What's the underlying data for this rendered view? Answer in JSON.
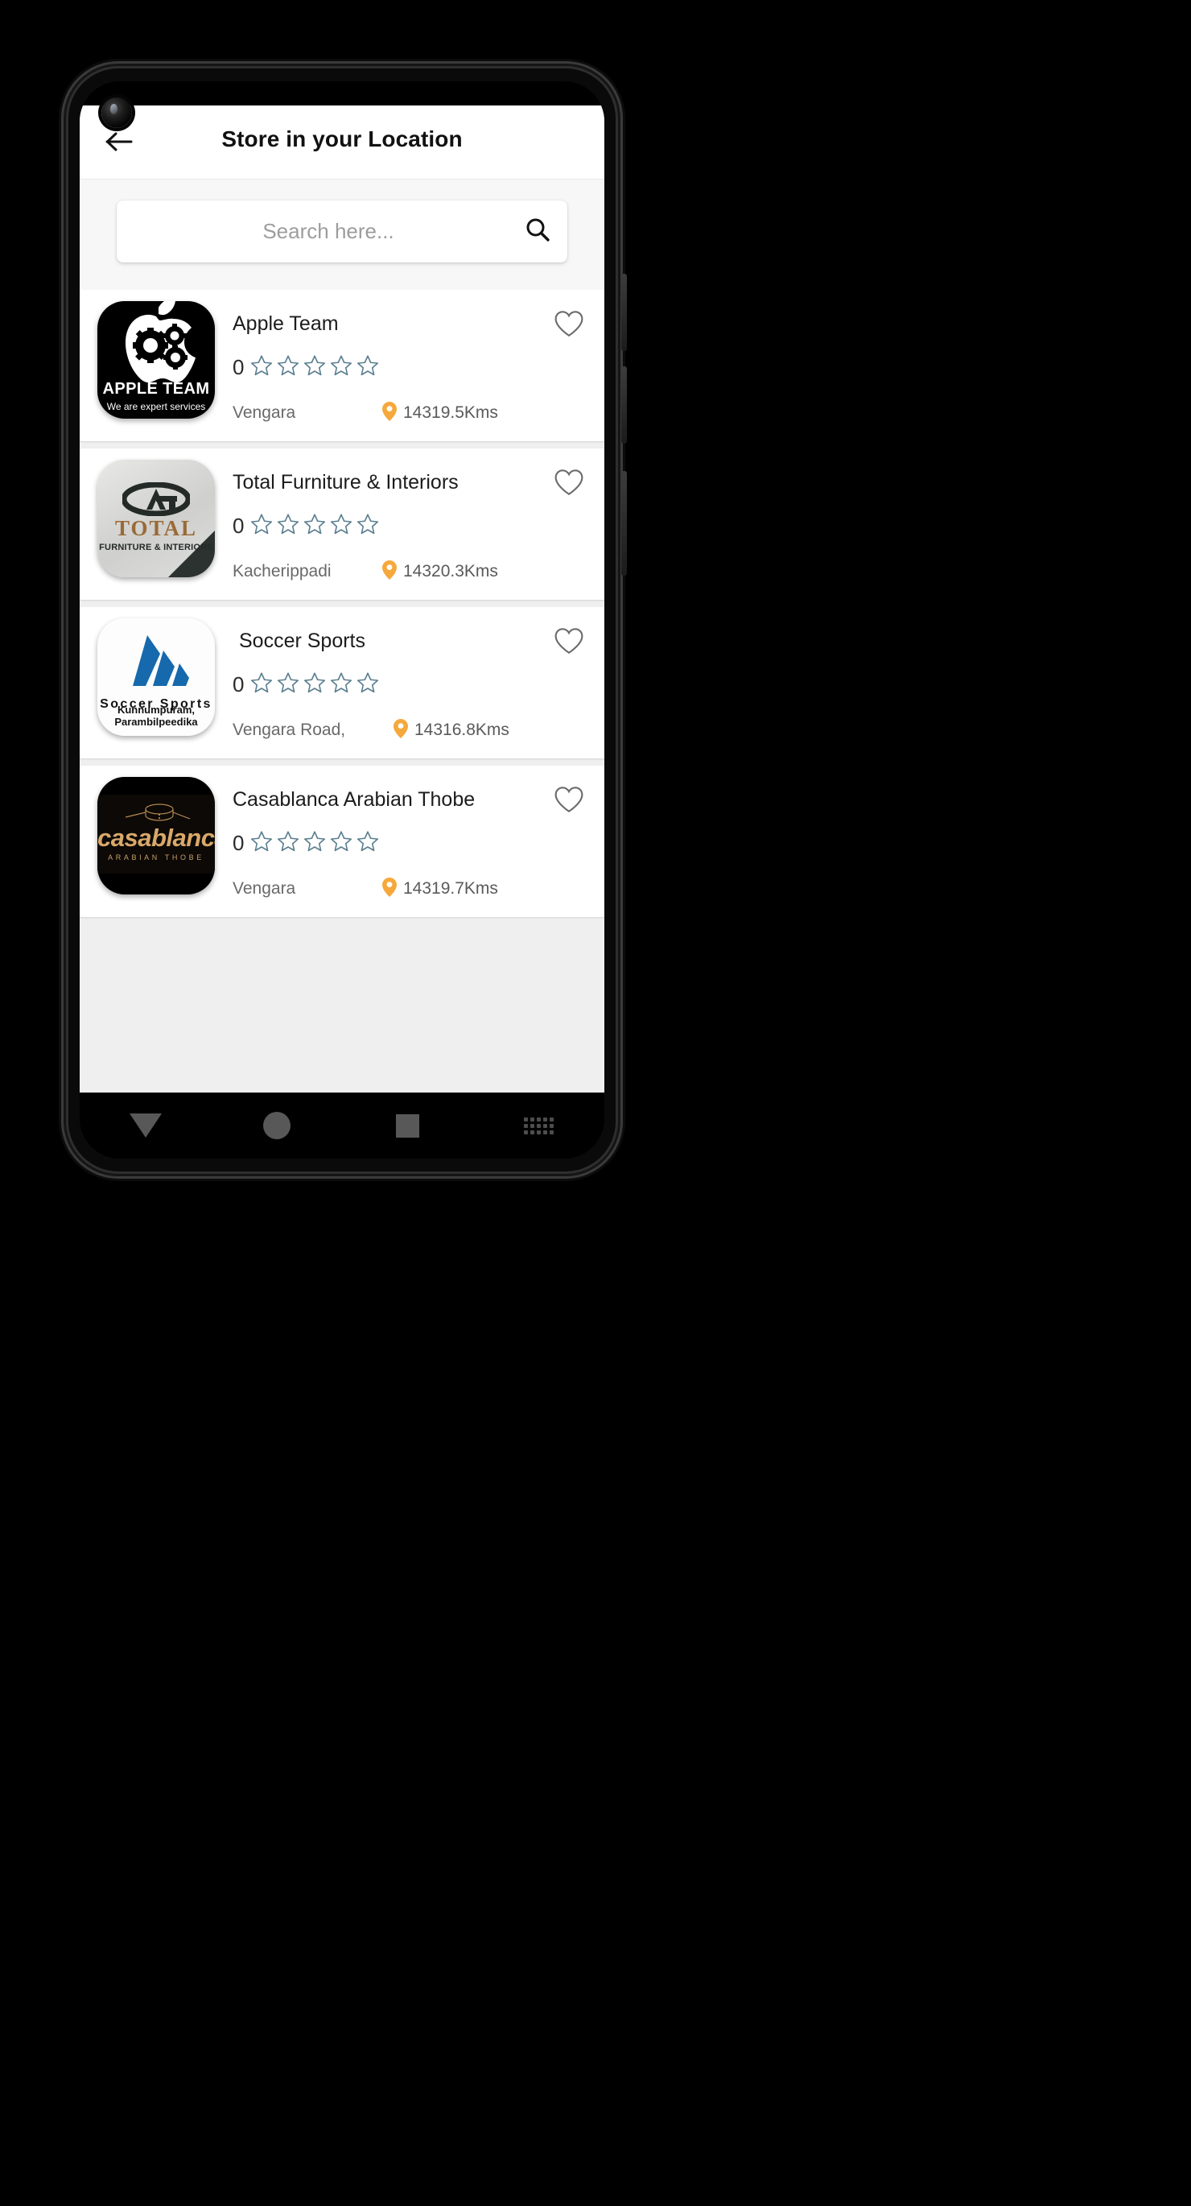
{
  "app_bar": {
    "title": "Store in your Location",
    "back_icon": "arrow-left-icon"
  },
  "search": {
    "placeholder": "Search here...",
    "value": "",
    "icon": "search-icon"
  },
  "colors": {
    "pin": "#F5A93C",
    "star_outline": "#5b7f8f",
    "heart_outline": "#6b6b6b",
    "screen_bg": "#efefef",
    "card_bg": "#ffffff"
  },
  "stores": [
    {
      "name": "Apple Team",
      "rating": "0",
      "stars": 5,
      "place": "Vengara",
      "distance": "14319.5Kms",
      "logo": {
        "kind": "apple-team-logo",
        "title": "APPLE TEAM",
        "subtitle": "We are expert services"
      }
    },
    {
      "name": "Total Furniture & Interiors",
      "rating": "0",
      "stars": 5,
      "place": "Kacherippadi",
      "distance": "14320.3Kms",
      "logo": {
        "kind": "total-furniture-logo",
        "title": "TOTAL",
        "subtitle": "FURNITURE & INTERIORS"
      }
    },
    {
      "name": "Soccer Sports",
      "rating": "0",
      "stars": 5,
      "place": "Vengara Road,",
      "distance": "14316.8Kms",
      "logo": {
        "kind": "soccer-sports-logo",
        "title": "Soccer Sports",
        "subtitle": "Kunnumpuram, Parambilpeedika"
      }
    },
    {
      "name": "Casablanca Arabian Thobe",
      "rating": "0",
      "stars": 5,
      "place": "Vengara",
      "distance": "14319.7Kms",
      "logo": {
        "kind": "casablanca-logo",
        "title": "casablanca",
        "subtitle": "ARABIAN THOBE"
      }
    }
  ],
  "nav_bar": {
    "back": "triangle-down-icon",
    "home": "circle-icon",
    "recents": "square-icon",
    "keyboard": "keyboard-icon"
  }
}
